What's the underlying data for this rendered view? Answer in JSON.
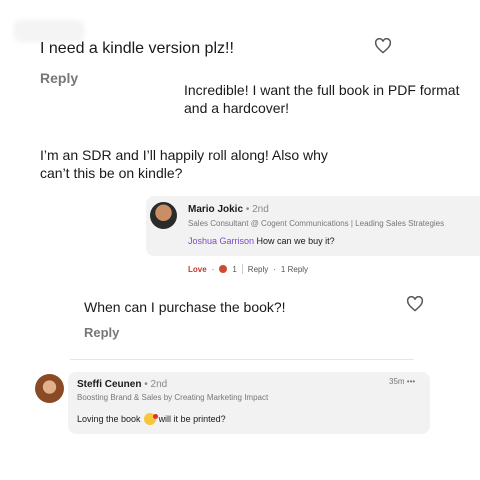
{
  "comments": [
    {
      "text": "I need a kindle version plz!!",
      "reply": "Reply"
    },
    {
      "text": "Incredible! I want the full book in PDF format and a hardcover!"
    },
    {
      "text": "I’m an SDR and I’ll happily roll along! Also why can’t this be on kindle?"
    },
    {
      "author": "Mario Jokic",
      "degree": "• 2nd",
      "headline": "Sales Consultant @ Cogent Communications | Leading Sales Strategies",
      "mention": "Joshua Garrison",
      "message": " How can we buy it?",
      "actions": {
        "love": "Love",
        "dot": "·",
        "reaction_count": "1",
        "reply": "Reply",
        "replies": "1 Reply"
      }
    },
    {
      "text": "When can I purchase the book?!",
      "reply": "Reply"
    },
    {
      "author": "Steffi Ceunen",
      "degree": "• 2nd",
      "headline": "Boosting Brand & Sales by Creating Marketing Impact",
      "time": "35m •••",
      "message_before": "Loving the book",
      "message_after": "will it be printed?"
    }
  ],
  "icons": {
    "heart": "heart-icon",
    "emoji": "smiling-hearts-emoji-icon",
    "reaction": "love-reaction-icon"
  }
}
